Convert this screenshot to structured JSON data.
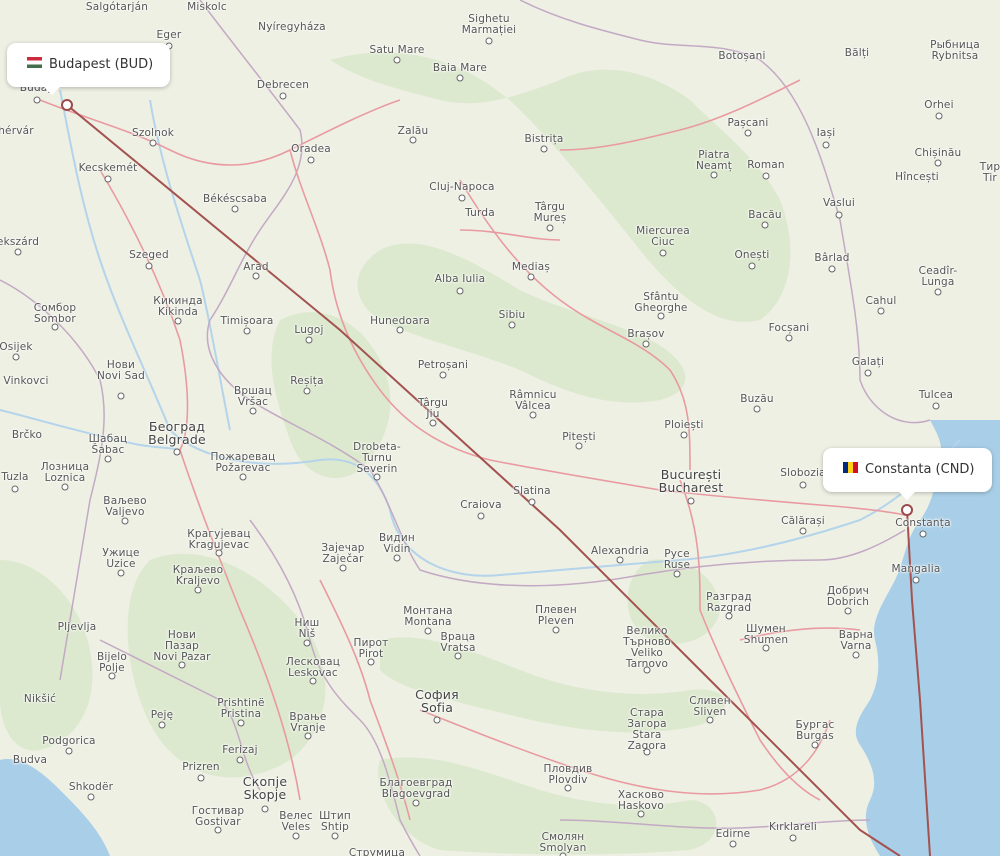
{
  "route": {
    "origin": {
      "label": "Budapest (BUD)",
      "country_flag": "hungary-flag"
    },
    "destination": {
      "label": "Constanta (CND)",
      "country_flag": "romania-flag"
    },
    "line_color": "#a3524f"
  },
  "colors": {
    "land": "#eef0e4",
    "sea": "#a9cfe8",
    "forest": "#d9e8cb",
    "road": "#e99aa0",
    "border": "#c3a9c4",
    "river": "#b3d4ea"
  },
  "cities": [
    {
      "id": "salgotarjan",
      "label": "Salgótarján"
    },
    {
      "id": "miskolc",
      "label": "Miskolc"
    },
    {
      "id": "sighetu",
      "label": "Sighetu\nMarmației"
    },
    {
      "id": "eger",
      "label": "Eger"
    },
    {
      "id": "nyiregyhaza",
      "label": "Nyíregyháza"
    },
    {
      "id": "satu-mare",
      "label": "Satu Mare"
    },
    {
      "id": "botosani",
      "label": "Botoșani"
    },
    {
      "id": "balti",
      "label": "Bălți"
    },
    {
      "id": "ribnita",
      "label": "Рыбница\nRybnitsa"
    },
    {
      "id": "budapest-partial",
      "label": "Budap"
    },
    {
      "id": "debrecen",
      "label": "Debrecen"
    },
    {
      "id": "baia-mare",
      "label": "Baia Mare"
    },
    {
      "id": "orhei",
      "label": "Orhei"
    },
    {
      "id": "pascani",
      "label": "Pașcani"
    },
    {
      "id": "iasi",
      "label": "Iași"
    },
    {
      "id": "szekesfehervar-partial",
      "label": "hérvár"
    },
    {
      "id": "szolnok",
      "label": "Szolnok"
    },
    {
      "id": "zalau",
      "label": "Zalău"
    },
    {
      "id": "bistrita",
      "label": "Bistrița"
    },
    {
      "id": "chisinau",
      "label": "Chișinău"
    },
    {
      "id": "oradea",
      "label": "Oradea"
    },
    {
      "id": "piatra-neamt",
      "label": "Piatra\nNeamț"
    },
    {
      "id": "roman",
      "label": "Roman"
    },
    {
      "id": "kecskemet",
      "label": "Kecskemét"
    },
    {
      "id": "hincesti",
      "label": "Hîncești"
    },
    {
      "id": "tiraspol-partial",
      "label": "Тир\nTir"
    },
    {
      "id": "cluj",
      "label": "Cluj-Napoca"
    },
    {
      "id": "bekescsaba",
      "label": "Békéscsaba"
    },
    {
      "id": "targu-mures",
      "label": "Târgu\nMureș"
    },
    {
      "id": "vaslui",
      "label": "Vaslui"
    },
    {
      "id": "turda",
      "label": "Turda"
    },
    {
      "id": "bacau",
      "label": "Bacău"
    },
    {
      "id": "miercurea",
      "label": "Miercurea\nCiuc"
    },
    {
      "id": "kecskemet-west",
      "label": "ekszárd"
    },
    {
      "id": "szeged",
      "label": "Szeged"
    },
    {
      "id": "onesti",
      "label": "Onești"
    },
    {
      "id": "barlad",
      "label": "Bârlad"
    },
    {
      "id": "arad",
      "label": "Arad"
    },
    {
      "id": "medias",
      "label": "Mediaș"
    },
    {
      "id": "ceadir",
      "label": "Ceadîr-\nLunga"
    },
    {
      "id": "alba-iulia",
      "label": "Alba Iulia"
    },
    {
      "id": "kikinda",
      "label": "Кикинда\nKikinda"
    },
    {
      "id": "sfantu",
      "label": "Sfântu\nGheorghe"
    },
    {
      "id": "cahul",
      "label": "Cahul"
    },
    {
      "id": "sombor",
      "label": "Сомбор\nSombor"
    },
    {
      "id": "sibiu",
      "label": "Sibiu"
    },
    {
      "id": "timisoara",
      "label": "Timișoara"
    },
    {
      "id": "hunedoara",
      "label": "Hunedoara"
    },
    {
      "id": "lugoj",
      "label": "Lugoj"
    },
    {
      "id": "focsani",
      "label": "Focșani"
    },
    {
      "id": "brasov",
      "label": "Brașov"
    },
    {
      "id": "osijek",
      "label": "Osijek"
    },
    {
      "id": "novi-sad",
      "label": "Нови\nNovi Sad"
    },
    {
      "id": "galati",
      "label": "Galați"
    },
    {
      "id": "petrosani",
      "label": "Petroșani"
    },
    {
      "id": "vinkovci",
      "label": "Vinkovci"
    },
    {
      "id": "resita",
      "label": "Reșița"
    },
    {
      "id": "vrsac",
      "label": "Вршац\nVršac"
    },
    {
      "id": "tulcea",
      "label": "Tulcea"
    },
    {
      "id": "ramnicu",
      "label": "Râmnicu\nVâlcea"
    },
    {
      "id": "buzau",
      "label": "Buzău"
    },
    {
      "id": "targu-jiu",
      "label": "Târgu\nJiu"
    },
    {
      "id": "ploiesti",
      "label": "Ploiești"
    },
    {
      "id": "belgrade",
      "label": "Београд\nBelgrade",
      "capital": true
    },
    {
      "id": "brcko",
      "label": "Brčko"
    },
    {
      "id": "sabac",
      "label": "Шабац\nŠabac"
    },
    {
      "id": "pitesti",
      "label": "Pitești"
    },
    {
      "id": "drobeta",
      "label": "Drobeta-\nTurnu\nSeverin"
    },
    {
      "id": "pozarevac",
      "label": "Пожаревац\nPožarevac"
    },
    {
      "id": "loznica",
      "label": "Лозница\nLoznica"
    },
    {
      "id": "tuzla",
      "label": "Tuzla"
    },
    {
      "id": "bucharest",
      "label": "București\nBucharest",
      "capital": true
    },
    {
      "id": "slobozia",
      "label": "Slobozia"
    },
    {
      "id": "valjevo",
      "label": "Ваљево\nValjevo"
    },
    {
      "id": "slatina",
      "label": "Slatina"
    },
    {
      "id": "craiova",
      "label": "Craiova"
    },
    {
      "id": "calarasi",
      "label": "Călărași"
    },
    {
      "id": "constanta",
      "label": "Constanța"
    },
    {
      "id": "kragujevac",
      "label": "Крагујевац\nKragujevac"
    },
    {
      "id": "vidin",
      "label": "Видин\nVidin"
    },
    {
      "id": "zajecar",
      "label": "Зајечар\nZaječar"
    },
    {
      "id": "alexandria",
      "label": "Alexandria"
    },
    {
      "id": "uzice",
      "label": "Ужице\nUzice"
    },
    {
      "id": "ruse",
      "label": "Русе\nRuse"
    },
    {
      "id": "kraljevo",
      "label": "Краљево\nKraljevo"
    },
    {
      "id": "mangalia",
      "label": "Mangalia"
    },
    {
      "id": "dobrich",
      "label": "Добрич\nDobrich"
    },
    {
      "id": "razgrad",
      "label": "Разград\nRazgrad"
    },
    {
      "id": "pleven",
      "label": "Плевен\nPleven"
    },
    {
      "id": "montana",
      "label": "Монтана\nMontana"
    },
    {
      "id": "pljevlja",
      "label": "Pljevlja"
    },
    {
      "id": "shumen",
      "label": "Шумен\nShumen"
    },
    {
      "id": "veliko",
      "label": "Велико\nТърново\nVeliko\nTarnovo"
    },
    {
      "id": "varna",
      "label": "Варна\nVarna"
    },
    {
      "id": "nis",
      "label": "Ниш\nNiš"
    },
    {
      "id": "vratsa",
      "label": "Враца\nVratsa"
    },
    {
      "id": "bijelo",
      "label": "Bijelo\nPolje"
    },
    {
      "id": "novi-pazar",
      "label": "Нови\nПазар\nNovi Pazar"
    },
    {
      "id": "pirot",
      "label": "Пирот\nPirot"
    },
    {
      "id": "leskovac",
      "label": "Лесковац\nLeskovac"
    },
    {
      "id": "sofia",
      "label": "София\nSofia",
      "capital": true
    },
    {
      "id": "niksic",
      "label": "Nikšić"
    },
    {
      "id": "sliven",
      "label": "Сливен\nSliven"
    },
    {
      "id": "pristina",
      "label": "Prishtinë\nPristina"
    },
    {
      "id": "stara-zagora",
      "label": "Стара\nЗагора\nStara\nZagora"
    },
    {
      "id": "pec",
      "label": "Peję"
    },
    {
      "id": "burgas",
      "label": "Бургас\nBurgas"
    },
    {
      "id": "vranje",
      "label": "Врање\nVranje"
    },
    {
      "id": "podgorica",
      "label": "Podgorica"
    },
    {
      "id": "ferizaj",
      "label": "Ferizaj"
    },
    {
      "id": "budva",
      "label": "Budva"
    },
    {
      "id": "prizren",
      "label": "Prizren"
    },
    {
      "id": "plovdiv",
      "label": "Пловдив\nPlovdiv"
    },
    {
      "id": "skopje",
      "label": "Скопје\nSkopje",
      "capital": true
    },
    {
      "id": "blagoevgrad",
      "label": "Благоевград\nBlagoevgrad"
    },
    {
      "id": "haskovo",
      "label": "Хасково\nHaskovo"
    },
    {
      "id": "shkoder",
      "label": "Shkodër"
    },
    {
      "id": "gostivar",
      "label": "Гостивар\nGostivar"
    },
    {
      "id": "veles",
      "label": "Велес\nVeles"
    },
    {
      "id": "stip",
      "label": "Штип\nShtip"
    },
    {
      "id": "edirne",
      "label": "Edirne"
    },
    {
      "id": "kirklareli",
      "label": "Kırklareli"
    },
    {
      "id": "smolyan",
      "label": "Смолян\nSmolyan"
    },
    {
      "id": "strumica",
      "label": "Струмица"
    }
  ]
}
